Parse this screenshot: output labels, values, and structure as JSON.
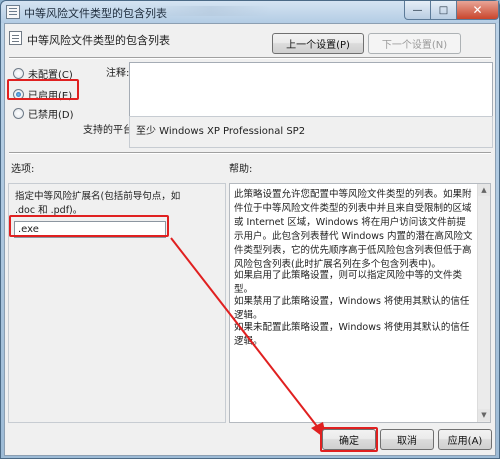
{
  "window": {
    "title": "中等风险文件类型的包含列表"
  },
  "header": {
    "title": "中等风险文件类型的包含列表"
  },
  "nav": {
    "prev_label": "上一个设置(P)",
    "next_label": "下一个设置(N)"
  },
  "radios": [
    {
      "label": "未配置(C)",
      "checked": false
    },
    {
      "label": "已启用(E)",
      "checked": true
    },
    {
      "label": "已禁用(D)",
      "checked": false
    }
  ],
  "comment": {
    "label": "注释:",
    "value": ""
  },
  "platform": {
    "label": "支持的平台:",
    "value": "至少 Windows XP Professional SP2"
  },
  "options": {
    "label": "选项:",
    "description": "指定中等风险扩展名(包括前导句点，如 .doc 和 .pdf)。",
    "value": ".exe"
  },
  "help": {
    "label": "帮助:",
    "paragraphs": [
      "此策略设置允许您配置中等风险文件类型的列表。如果附件位于中等风险文件类型的列表中并且来自受限制的区域或 Internet 区域，Windows 将在用户访问该文件前提示用户。此包含列表替代 Windows 内置的潜在高风险文件类型列表，它的优先顺序高于低风险包含列表但低于高风险包含列表(此时扩展名列在多个包含列表中)。",
      "如果启用了此策略设置，则可以指定风险中等的文件类型。",
      "如果禁用了此策略设置，Windows 将使用其默认的信任逻辑。",
      "如果未配置此策略设置，Windows 将使用其默认的信任逻辑。"
    ]
  },
  "buttons": {
    "ok": "确定",
    "cancel": "取消",
    "apply": "应用(A)"
  },
  "colors": {
    "highlight": "#e02020",
    "accent": "#1c5fa8"
  }
}
